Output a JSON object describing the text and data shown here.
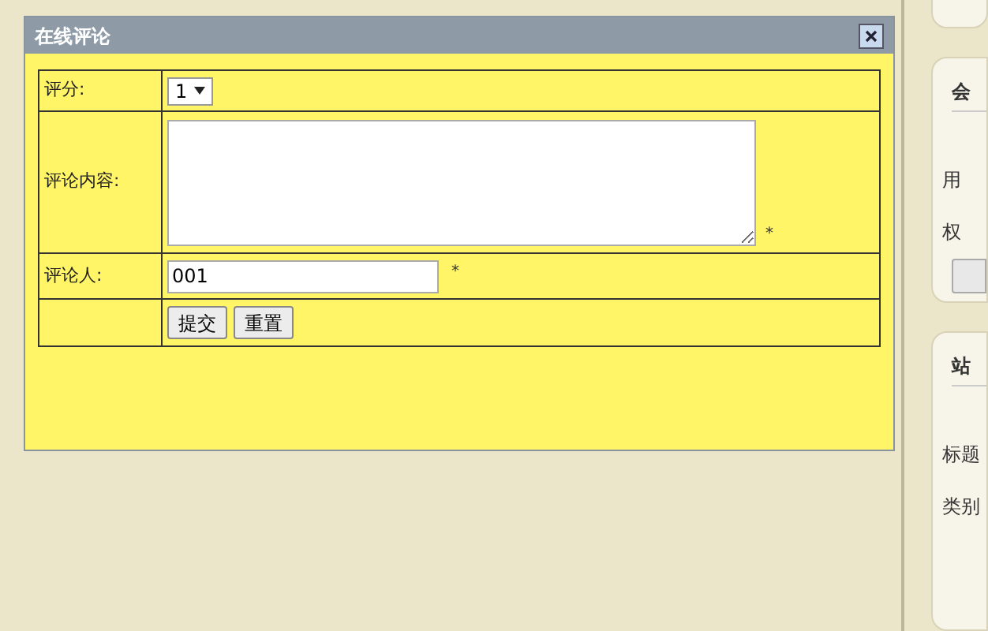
{
  "dialog": {
    "title": "在线评论",
    "form": {
      "rating": {
        "label": "评分:",
        "value": "1"
      },
      "content": {
        "label": "评论内容:",
        "required_mark": "*"
      },
      "reviewer": {
        "label": "评论人:",
        "value": "001",
        "required_mark": "*"
      },
      "buttons": [
        "提交",
        "重置"
      ]
    }
  },
  "side_panels": [
    {
      "heading": "会",
      "lines": [
        "用",
        "权"
      ],
      "has_button": true
    },
    {
      "heading": "站",
      "lines": [
        "标题",
        "类别"
      ],
      "has_button": false
    }
  ]
}
